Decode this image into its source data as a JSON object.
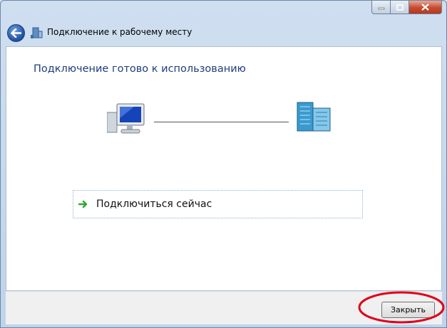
{
  "window": {
    "title": "Подключение к рабочему месту"
  },
  "content": {
    "heading": "Подключение готово к использованию",
    "connect_label": "Подключиться сейчас"
  },
  "footer": {
    "close_label": "Закрыть"
  },
  "icons": {
    "back": "back-arrow-icon",
    "app": "network-connection-icon",
    "computer": "computer-icon",
    "server": "server-building-icon",
    "connect_arrow": "green-arrow-icon"
  },
  "colors": {
    "heading": "#1e3d7b",
    "highlight_ellipse": "#e0001a",
    "connect_arrow": "#2fa82f"
  }
}
